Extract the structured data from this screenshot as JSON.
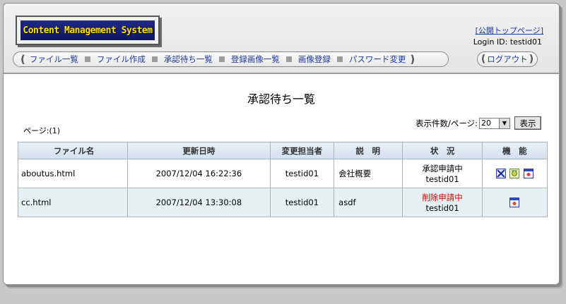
{
  "header": {
    "logo_text": "Content Management System",
    "public_top_link": "[公開トップページ]",
    "login_id": "Login ID: testid01",
    "logout_label": "ログアウト"
  },
  "nav": {
    "items": [
      "ファイル一覧",
      "ファイル作成",
      "承認待ち一覧",
      "登録画像一覧",
      "画像登録",
      "パスワード変更"
    ]
  },
  "page": {
    "title": "承認待ち一覧",
    "page_indicator": "ページ:(1)",
    "per_page_label": "表示件数/ページ:",
    "per_page_value": "20",
    "show_button": "表示"
  },
  "table": {
    "headers": [
      "ファイル名",
      "更新日時",
      "変更担当者",
      "説　明",
      "状　況",
      "機　能"
    ],
    "rows": [
      {
        "file": "aboutus.html",
        "updated": "2007/12/04 16:22:36",
        "editor": "testid01",
        "description": "会社概要",
        "status": "承認申請中",
        "status_user": "testid01"
      },
      {
        "file": "cc.html",
        "updated": "2007/12/04 13:30:08",
        "editor": "testid01",
        "description": "asdf",
        "status": "削除申請中",
        "status_user": "testid01"
      }
    ]
  },
  "colors": {
    "link": "#1a3b9b",
    "logo_text": "#ffe000",
    "logo_bg": "#1f2a86",
    "delete_status": "#d00000",
    "table_header": "#d2e0ee",
    "alt_row": "#e7f1f4"
  }
}
